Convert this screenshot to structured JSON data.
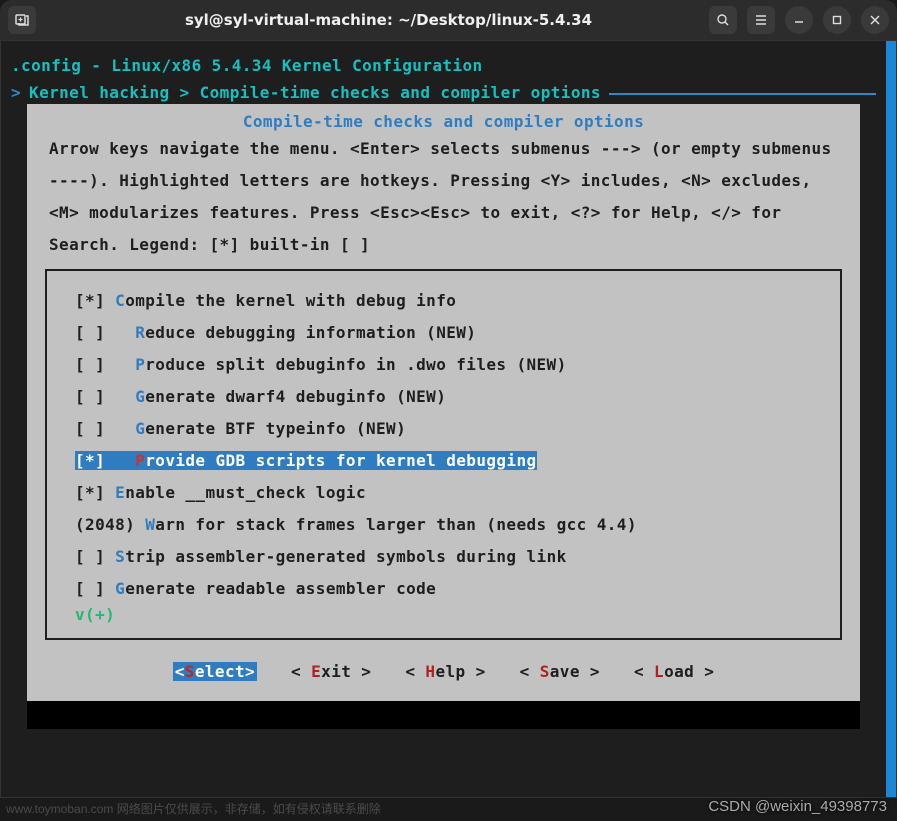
{
  "window": {
    "title": "syl@syl-virtual-machine: ~/Desktop/linux-5.4.34"
  },
  "config_header": ".config - Linux/x86 5.4.34 Kernel Configuration",
  "breadcrumb_prefix": "> ",
  "breadcrumb": "Kernel hacking > Compile-time checks and compiler options",
  "dialog": {
    "title": "Compile-time checks and compiler options",
    "help": "Arrow keys navigate the menu.  <Enter> selects submenus ---> (or empty submenus ----).  Highlighted letters are hotkeys.  Pressing <Y> includes, <N> excludes, <M> modularizes features.  Press <Esc><Esc> to exit, <?> for Help, </> for Search.  Legend: [*] built-in  [ ]"
  },
  "menu": [
    {
      "prefix": "[*] ",
      "indent": "",
      "hk": "C",
      "text": "ompile the kernel with debug info",
      "selected": false
    },
    {
      "prefix": "[ ]   ",
      "indent": "",
      "hk": "R",
      "text": "educe debugging information (NEW)",
      "selected": false
    },
    {
      "prefix": "[ ]   ",
      "indent": "",
      "hk": "P",
      "text": "roduce split debuginfo in .dwo files (NEW)",
      "selected": false
    },
    {
      "prefix": "[ ]   ",
      "indent": "",
      "hk": "G",
      "text": "enerate dwarf4 debuginfo (NEW)",
      "selected": false
    },
    {
      "prefix": "[ ]   ",
      "indent": "",
      "hk": "G",
      "text": "enerate BTF typeinfo (NEW)",
      "selected": false
    },
    {
      "prefix": "[*]   ",
      "indent": "",
      "hk": "P",
      "text": "rovide GDB scripts for kernel debugging",
      "selected": true
    },
    {
      "prefix": "[*] ",
      "indent": "",
      "hk": "E",
      "text": "nable __must_check logic",
      "selected": false
    },
    {
      "prefix": "(2048) ",
      "indent": "",
      "hk": "W",
      "text": "arn for stack frames larger than (needs gcc 4.4)",
      "selected": false
    },
    {
      "prefix": "[ ] ",
      "indent": "",
      "hk": "S",
      "text": "trip assembler-generated symbols during link",
      "selected": false
    },
    {
      "prefix": "[ ] ",
      "indent": "",
      "hk": "G",
      "text": "enerate readable assembler code",
      "selected": false
    }
  ],
  "more_indicator": "v(+)",
  "buttons": [
    {
      "pre": "<",
      "hk": "S",
      "post": "elect>",
      "active": true
    },
    {
      "pre": "< ",
      "hk": "E",
      "post": "xit >",
      "active": false
    },
    {
      "pre": "< ",
      "hk": "H",
      "post": "elp >",
      "active": false
    },
    {
      "pre": "< ",
      "hk": "S",
      "post": "ave >",
      "active": false
    },
    {
      "pre": "< ",
      "hk": "L",
      "post": "oad >",
      "active": false
    }
  ],
  "watermark_bl": "www.toymoban.com 网络图片仅供展示，非存储，如有侵权请联系删除",
  "watermark_br": "CSDN @weixin_49398773"
}
